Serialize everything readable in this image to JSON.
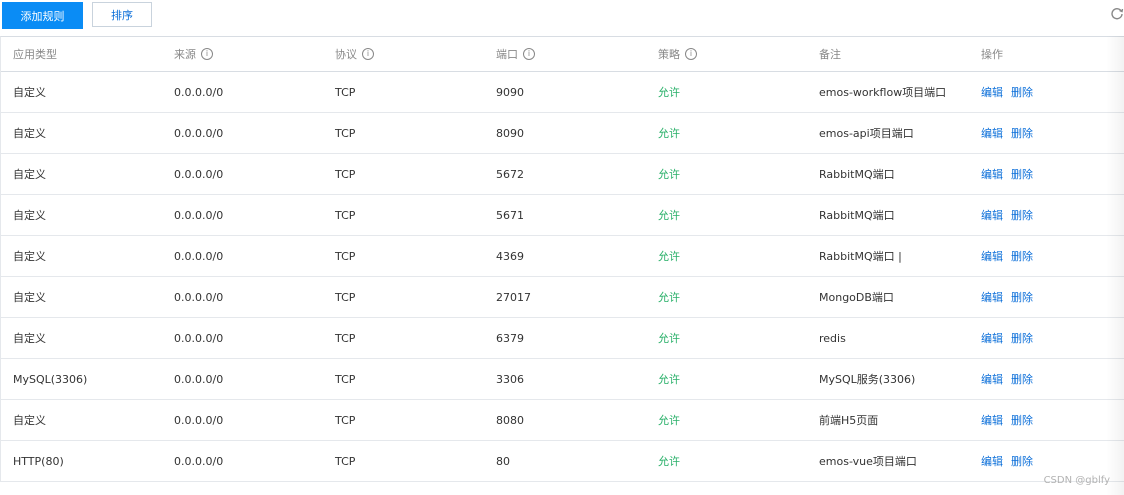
{
  "toolbar": {
    "add_rule_label": "添加规则",
    "sort_label": "排序",
    "refresh_icon": "refresh-icon"
  },
  "table": {
    "headers": [
      "应用类型",
      "来源",
      "协议",
      "端口",
      "策略",
      "备注",
      "操作"
    ],
    "info_headers": [
      1,
      2,
      3,
      4
    ],
    "rows": [
      {
        "app_type": "自定义",
        "source": "0.0.0.0/0",
        "protocol": "TCP",
        "port": "9090",
        "policy": "允许",
        "note": "emos-workflow项目端口",
        "edit": "编辑",
        "delete": "删除"
      },
      {
        "app_type": "自定义",
        "source": "0.0.0.0/0",
        "protocol": "TCP",
        "port": "8090",
        "policy": "允许",
        "note": "emos-api项目端口",
        "edit": "编辑",
        "delete": "删除"
      },
      {
        "app_type": "自定义",
        "source": "0.0.0.0/0",
        "protocol": "TCP",
        "port": "5672",
        "policy": "允许",
        "note": "RabbitMQ端口",
        "edit": "编辑",
        "delete": "删除"
      },
      {
        "app_type": "自定义",
        "source": "0.0.0.0/0",
        "protocol": "TCP",
        "port": "5671",
        "policy": "允许",
        "note": "RabbitMQ端口",
        "edit": "编辑",
        "delete": "删除"
      },
      {
        "app_type": "自定义",
        "source": "0.0.0.0/0",
        "protocol": "TCP",
        "port": "4369",
        "policy": "允许",
        "note": "RabbitMQ端口 |",
        "edit": "编辑",
        "delete": "删除"
      },
      {
        "app_type": "自定义",
        "source": "0.0.0.0/0",
        "protocol": "TCP",
        "port": "27017",
        "policy": "允许",
        "note": "MongoDB端口",
        "edit": "编辑",
        "delete": "删除"
      },
      {
        "app_type": "自定义",
        "source": "0.0.0.0/0",
        "protocol": "TCP",
        "port": "6379",
        "policy": "允许",
        "note": "redis",
        "edit": "编辑",
        "delete": "删除"
      },
      {
        "app_type": "MySQL(3306)",
        "source": "0.0.0.0/0",
        "protocol": "TCP",
        "port": "3306",
        "policy": "允许",
        "note": "MySQL服务(3306)",
        "edit": "编辑",
        "delete": "删除"
      },
      {
        "app_type": "自定义",
        "source": "0.0.0.0/0",
        "protocol": "TCP",
        "port": "8080",
        "policy": "允许",
        "note": "前端H5页面",
        "edit": "编辑",
        "delete": "删除"
      },
      {
        "app_type": "HTTP(80)",
        "source": "0.0.0.0/0",
        "protocol": "TCP",
        "port": "80",
        "policy": "允许",
        "note": "emos-vue项目端口",
        "edit": "编辑",
        "delete": "删除"
      }
    ]
  },
  "colors": {
    "primary": "#0a8cf5",
    "link": "#0a6ed9",
    "allow": "#29b069"
  },
  "watermark": "CSDN @gblfy"
}
